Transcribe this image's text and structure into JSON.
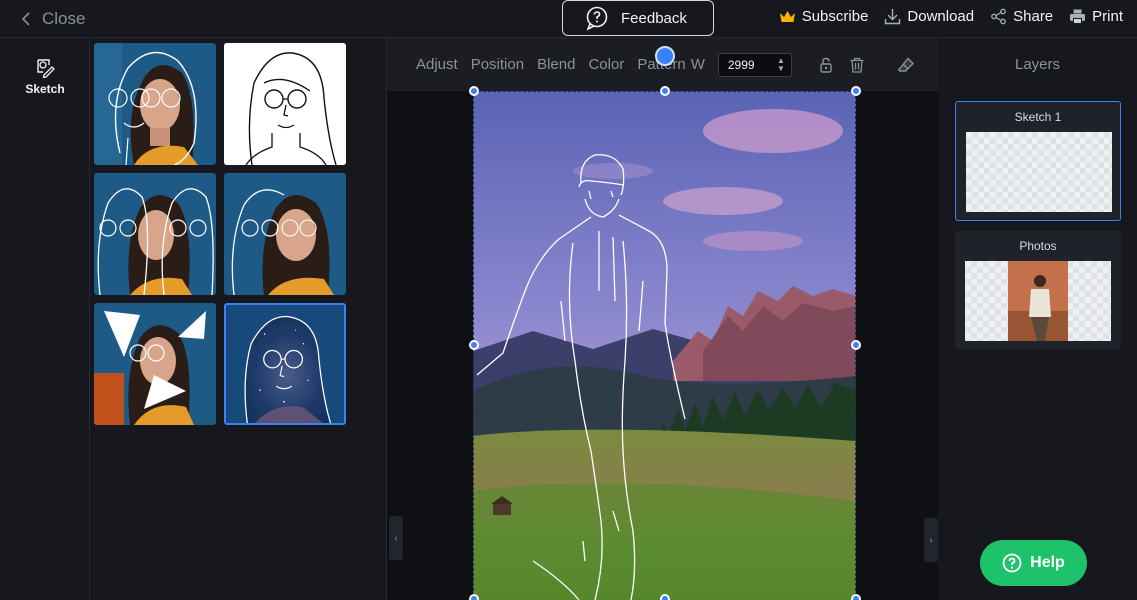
{
  "topbar": {
    "close_label": "Close",
    "feedback_label": "Feedback",
    "subscribe_label": "Subscribe",
    "download_label": "Download",
    "share_label": "Share",
    "print_label": "Print"
  },
  "rail": {
    "sketch_label": "Sketch"
  },
  "toolbar": {
    "adjust": "Adjust",
    "position": "Position",
    "blend": "Blend",
    "color": "Color",
    "pattern": "Pattern",
    "width_label": "W",
    "width_value": "2999"
  },
  "layers": {
    "title": "Layers",
    "items": [
      {
        "label": "Sketch 1"
      },
      {
        "label": "Photos"
      }
    ]
  },
  "help_label": "Help",
  "colors": {
    "accent": "#3b82f6",
    "help": "#1ec26a",
    "crown": "#f5b400"
  }
}
